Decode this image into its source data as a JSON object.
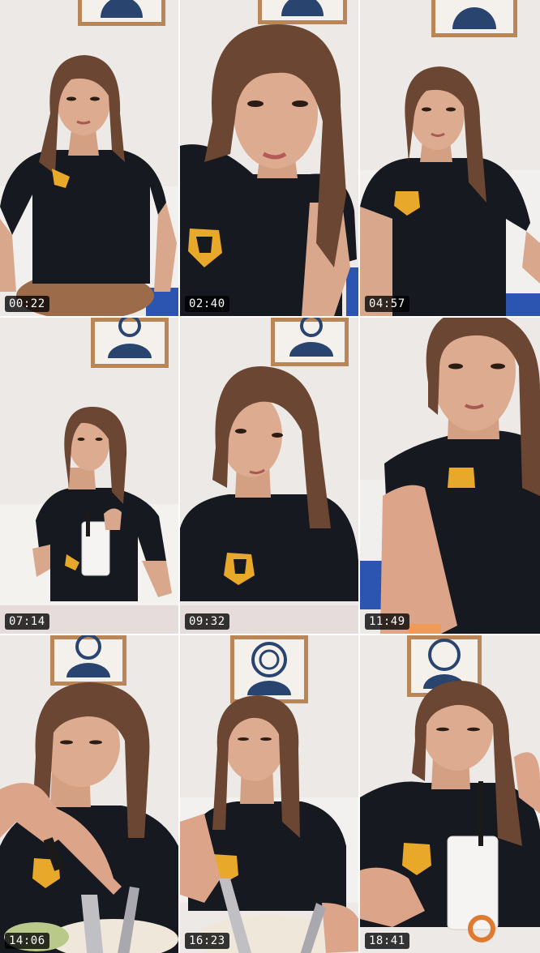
{
  "frames": [
    {
      "timestamp": "00:22"
    },
    {
      "timestamp": "02:40"
    },
    {
      "timestamp": "04:57"
    },
    {
      "timestamp": "07:14"
    },
    {
      "timestamp": "09:32"
    },
    {
      "timestamp": "11:49"
    },
    {
      "timestamp": "14:06"
    },
    {
      "timestamp": "16:23"
    },
    {
      "timestamp": "18:41"
    }
  ],
  "colors": {
    "wall": "#ebe8e4",
    "frame_wood": "#b98658",
    "art_navy": "#2a4470",
    "shirt": "#16191f",
    "skin": "#d9a88c",
    "hair": "#6b4632",
    "logo_gold": "#e8a92a",
    "stamp_bg": "#000000"
  }
}
